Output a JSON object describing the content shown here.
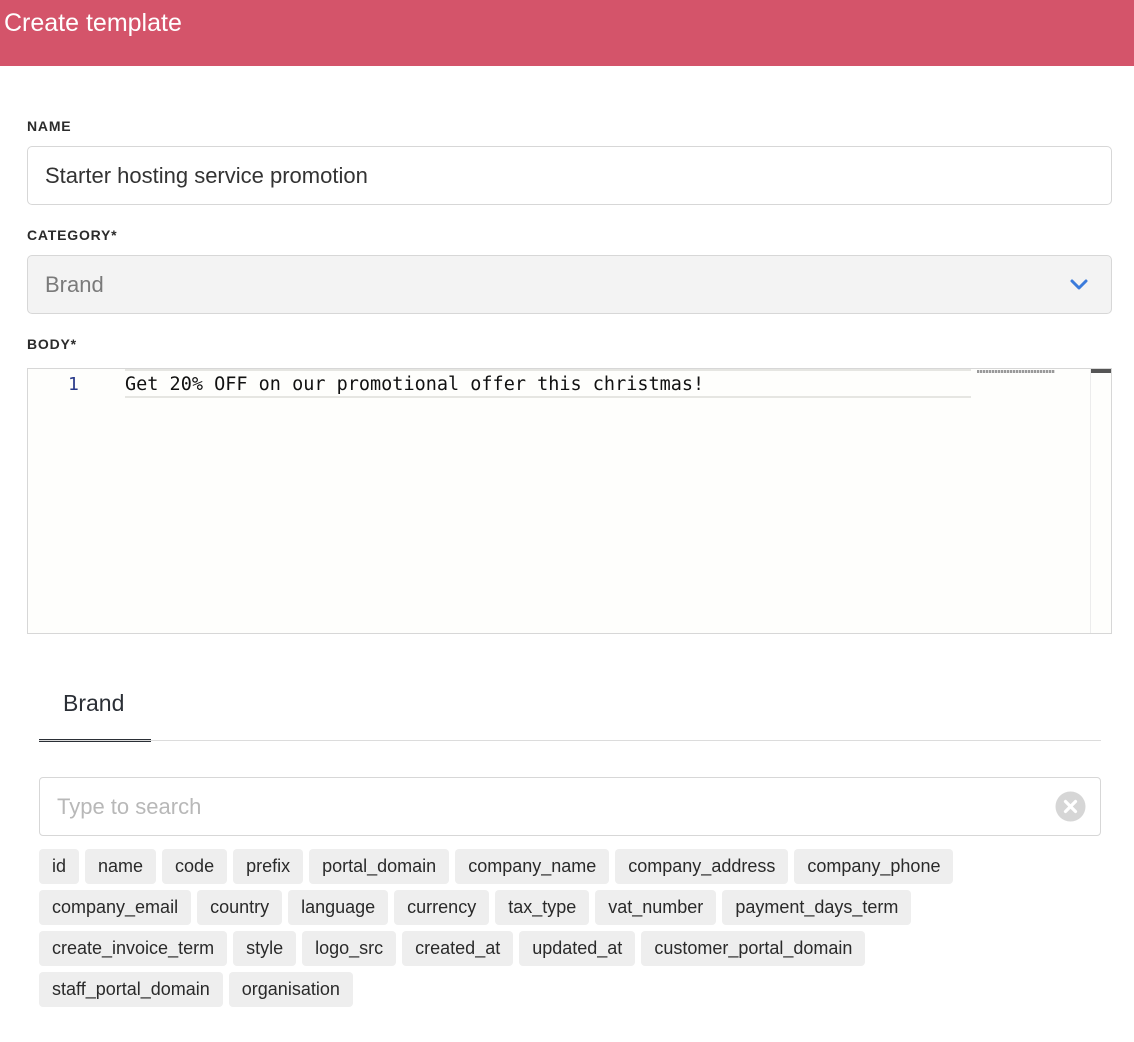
{
  "header": {
    "title": "Create template"
  },
  "form": {
    "name_label": "NAME",
    "name_value": "Starter hosting service promotion",
    "category_label": "CATEGORY*",
    "category_value": "Brand",
    "body_label": "BODY*"
  },
  "editor": {
    "line_number": "1",
    "line_text": "Get 20% OFF on our promotional offer this christmas!"
  },
  "tabs": [
    {
      "label": "Brand",
      "active": true
    }
  ],
  "search": {
    "placeholder": "Type to search",
    "value": ""
  },
  "tag_rows": [
    [
      "id",
      "name",
      "code",
      "prefix",
      "portal_domain",
      "company_name",
      "company_address",
      "company_phone"
    ],
    [
      "company_email",
      "country",
      "language",
      "currency",
      "tax_type",
      "vat_number",
      "payment_days_term"
    ],
    [
      "create_invoice_term",
      "style",
      "logo_src",
      "created_at",
      "updated_at",
      "customer_portal_domain"
    ],
    [
      "staff_portal_domain",
      "organisation"
    ]
  ],
  "colors": {
    "header_bg": "#d4546a",
    "chevron": "#3b7bdb",
    "tag_bg": "#eeeeee",
    "tab_underline": "#2b2f36"
  },
  "icons": {
    "select": "chevron-down-icon",
    "search_clear": "clear-circle-icon"
  }
}
